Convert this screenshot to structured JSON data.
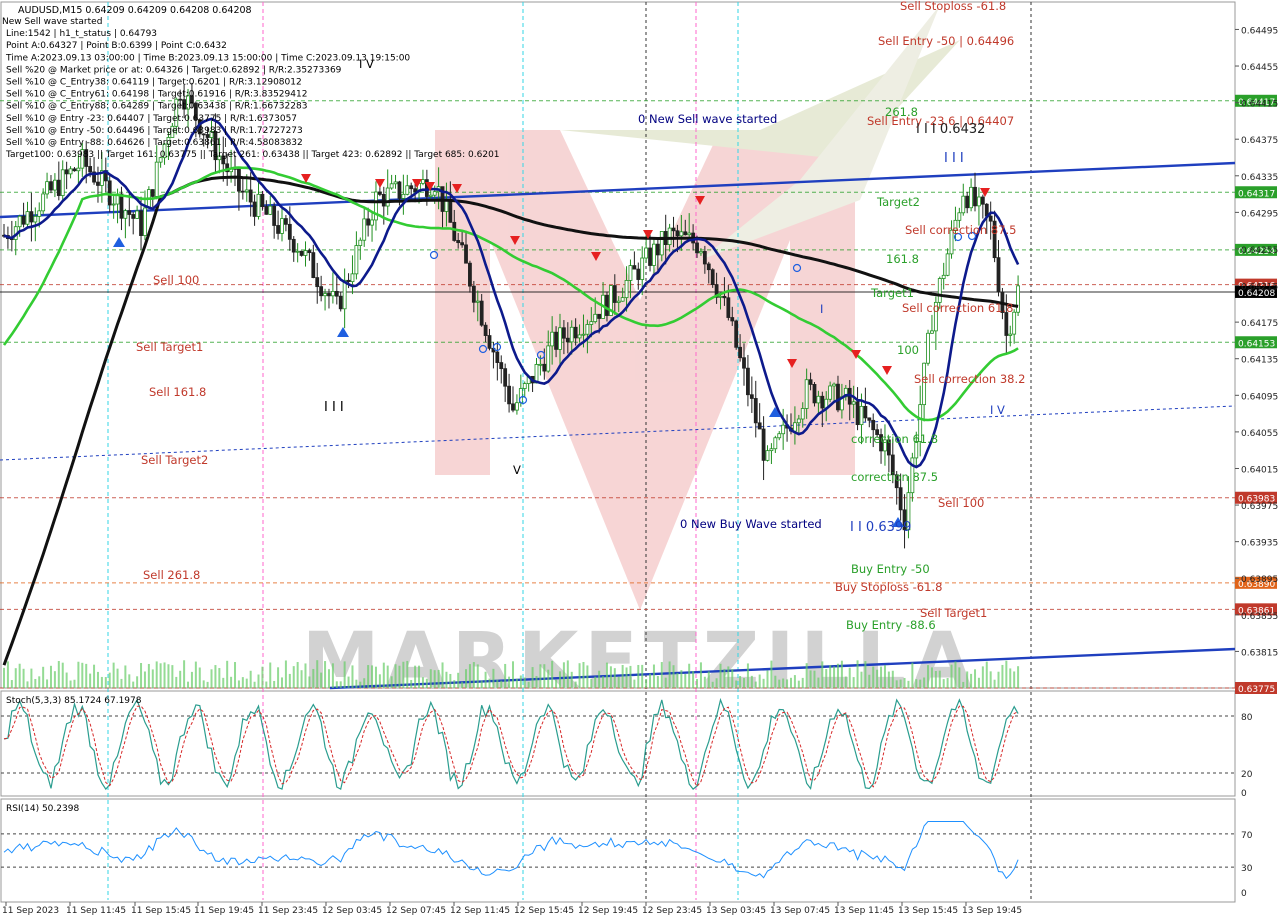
{
  "chart_data": {
    "type": "candlestick",
    "symbol_line": "AUDUSD,M15  0.64209 0.64209 0.64208 0.64208",
    "info_lines": [
      "New Sell wave started",
      "Line:1542 | h1_t_status | 0.64793",
      "Point A:0.64327 | Point B:0.6399 | Point C:0.6432",
      "Time A:2023.09.13 03:00:00 | Time B:2023.09.13 15:00:00 | Time C:2023.09.13 19:15:00",
      "Sell %20 @ Market price or at: 0.64326 | Target:0.62892 | R/R:2.35273369",
      "Sell %10 @ C_Entry38: 0.64119 | Target:0.6201 | R/R:3.12908012",
      "Sell %10 @ C_Entry61: 0.64198 | Target:0.61916 | R/R:3.83529412",
      "Sell %10 @ C_Entry88: 0.64289 | Target:0.63438 | R/R:1.66732283",
      "Sell %10 @ Entry -23: 0.64407 | Target:0.63775 | R/R:1.6373057",
      "Sell %10 @ Entry -50: 0.64496 | Target:0.63983 | R/R:1.72727273",
      "Sell %10 @ Entry -88: 0.64626 | Target:0.63861 | R/R:4.58083832",
      "Target100: 0.63983 || Target 161: 0.63775 || Target 261: 0.63438 || Target 423: 0.62892 || Target 685: 0.6201"
    ],
    "price_axis": {
      "ticks": [
        "0.64495",
        "0.64455",
        "0.64415",
        "0.64375",
        "0.64335",
        "0.64295",
        "0.64255",
        "0.64215",
        "0.64175",
        "0.64135",
        "0.64095",
        "0.64055",
        "0.64015",
        "0.63975",
        "0.63935",
        "0.63895",
        "0.63855",
        "0.63815"
      ],
      "range": [
        0.63775,
        0.64525
      ]
    },
    "price_tags": [
      {
        "text": "0.64417",
        "value": 0.64417,
        "color": "#2aa02a"
      },
      {
        "text": "0.64317",
        "value": 0.64317,
        "color": "#2aa02a"
      },
      {
        "text": "0.64254",
        "value": 0.64254,
        "color": "#2aa02a"
      },
      {
        "text": "0.64216",
        "value": 0.64216,
        "color": "#c0392b"
      },
      {
        "text": "0.64208",
        "value": 0.64208,
        "color": "#000000"
      },
      {
        "text": "0.64153",
        "value": 0.64153,
        "color": "#2aa02a"
      },
      {
        "text": "0.63983",
        "value": 0.63983,
        "color": "#c0392b"
      },
      {
        "text": "0.63890",
        "value": 0.6389,
        "color": "#e0641a"
      },
      {
        "text": "0.63861",
        "value": 0.63861,
        "color": "#c0392b"
      },
      {
        "text": "0.63775",
        "value": 0.63775,
        "color": "#c0392b"
      }
    ],
    "annotations": [
      {
        "text": "Sell Stoploss -61.8",
        "color": "#c0392b",
        "value": 0.6452
      },
      {
        "text": "Sell Entry -50 | 0.64496",
        "color": "#c0392b",
        "value": 0.64493
      },
      {
        "text": "261.8",
        "color": "#2aa02a",
        "value": 0.64413
      },
      {
        "text": "Sell Entry -23.6 | 0.64407",
        "color": "#c0392b",
        "value": 0.64398
      },
      {
        "text": "I I I 0.6432",
        "color": "#222222",
        "value": 0.64388
      },
      {
        "text": "I I I",
        "color": "#1f3fbf",
        "value": 0.64356
      },
      {
        "text": "Target2",
        "color": "#2aa02a",
        "value": 0.64305
      },
      {
        "text": "Sell correction 87.5",
        "color": "#c0392b",
        "value": 0.64275
      },
      {
        "text": "161.8",
        "color": "#2aa02a",
        "value": 0.64243
      },
      {
        "text": "Target1",
        "color": "#2aa02a",
        "value": 0.64203
      },
      {
        "text": "Sell correction 61.8",
        "color": "#c0392b",
        "value": 0.64186
      },
      {
        "text": "100",
        "color": "#2aa02a",
        "value": 0.64144
      },
      {
        "text": "Sell correction 38.2",
        "color": "#c0392b",
        "value": 0.64113
      },
      {
        "text": "I V",
        "color": "#1f3fbf",
        "value": 0.64077
      },
      {
        "text": "Sell 100",
        "color": "#c0392b",
        "value": 0.63972
      },
      {
        "text": "Buy Entry -50",
        "color": "#2aa02a",
        "value": 0.63904
      },
      {
        "text": "Buy Stoploss -61.8",
        "color": "#c0392b",
        "value": 0.63881
      },
      {
        "text": "Sell Target1",
        "color": "#c0392b",
        "value": 0.63853
      },
      {
        "text": "Buy Entry -88.6",
        "color": "#2aa02a",
        "value": 0.63831
      },
      {
        "text": "0 New Sell wave started",
        "color": "#000080",
        "value": 0.64422
      },
      {
        "text": "0 New Buy Wave started",
        "color": "#000080",
        "value": 0.6395
      },
      {
        "text": "Sell 100",
        "color": "#c0392b",
        "value": 0.64222
      },
      {
        "text": "Sell Target1",
        "color": "#c0392b",
        "value": 0.6416
      },
      {
        "text": "Sell 161.8",
        "color": "#c0392b",
        "value": 0.6411
      },
      {
        "text": "Sell Target2",
        "color": "#c0392b",
        "value": 0.6403
      },
      {
        "text": "Sell  261.8",
        "color": "#c0392b",
        "value": 0.6389
      },
      {
        "text": "I I I",
        "color": "#000000",
        "value": 0.64083
      },
      {
        "text": "I V",
        "color": "#000000",
        "value": 0.6447
      },
      {
        "text": "V",
        "color": "#000000",
        "value": 0.64012
      },
      {
        "text": "I",
        "color": "#1f3fbf",
        "value": 0.64185
      },
      {
        "text": "I I 0.6399",
        "color": "#1f3fbf",
        "value": 0.63946
      },
      {
        "text": "correction 87.5",
        "color": "#2aa02a",
        "value": 0.6401
      },
      {
        "text": "correction 61.8",
        "color": "#2aa02a",
        "value": 0.64052
      }
    ],
    "x_labels": [
      "11 Sep 2023",
      "11 Sep 11:45",
      "11 Sep 15:45",
      "11 Sep 19:45",
      "11 Sep 23:45",
      "12 Sep 03:45",
      "12 Sep 07:45",
      "12 Sep 11:45",
      "12 Sep 15:45",
      "12 Sep 19:45",
      "12 Sep 23:45",
      "13 Sep 03:45",
      "13 Sep 07:45",
      "13 Sep 11:45",
      "13 Sep 15:45",
      "13 Sep 19:45"
    ],
    "stoch": {
      "label": "Stoch(5,3,3) 85.1724 67.1978",
      "levels": [
        "80",
        "20",
        "0"
      ]
    },
    "rsi": {
      "label": "RSI(14) 50.2398",
      "levels": [
        "70",
        "30",
        "0"
      ]
    },
    "watermark": "MARKETZILLA",
    "colors": {
      "ma_blue": "#0d1a8c",
      "ma_green": "#33cc33",
      "ma_black": "#111111",
      "trend": "#1f3fbf",
      "sell": "#e62020",
      "buy": "#1f5fe0",
      "bull": "#1f8f1f",
      "bear": "#222222"
    }
  }
}
